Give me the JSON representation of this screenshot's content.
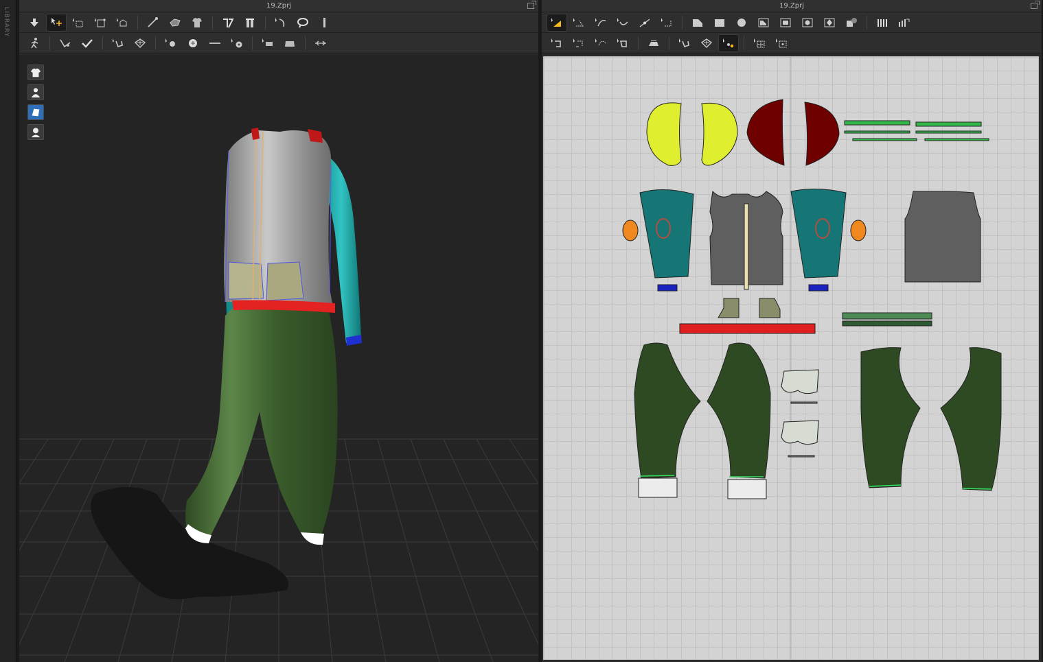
{
  "library": {
    "label": "LIBRARY"
  },
  "left_panel": {
    "title": "19.Zprj"
  },
  "right_panel": {
    "title": "19.Zprj"
  },
  "left_toolbar": {
    "row1": [
      "move-icon",
      "select-add-icon",
      "box-select-icon",
      "transform-icon",
      "rotate-icon",
      "segment-icon",
      "fold-icon",
      "garment-icon",
      "tack-icon",
      "pin-icon",
      "arrow-curve-icon",
      "lasso-icon",
      "ruler-icon"
    ],
    "row2": [
      "walk-icon",
      "simulate-icon",
      "check-icon",
      "edit-stitch-icon",
      "fabric-icon",
      "button-icon",
      "dot-icon",
      "line-icon",
      "lock-icon",
      "topstitch-icon",
      "flat-icon",
      "measure-icon"
    ]
  },
  "right_toolbar": {
    "row1": [
      "edit-pattern-icon",
      "select-points-icon",
      "curve-point-icon",
      "edit-curve-icon",
      "add-point-icon",
      "polygon-icon",
      "rectangle-icon",
      "circle-icon",
      "internal-polygon-icon",
      "internal-rect-icon",
      "internal-circle-icon",
      "dart-icon",
      "trace-icon",
      "stitch-icon",
      "fold-arr-icon"
    ],
    "row2": [
      "sew-segment-icon",
      "sew-free-icon",
      "m-n-sew-icon",
      "check-sew-icon",
      "iron-icon",
      "edit-sew-icon",
      "fabric-sew-icon",
      "symmetry-icon",
      "grid-select-icon",
      "grid-point-icon"
    ]
  },
  "colors": {
    "accent": "#f5b820",
    "yellow_piece": "#dfee2e",
    "maroon_piece": "#6e0000",
    "teal_piece": "#167575",
    "gray_piece": "#5f5f5f",
    "green_piece": "#2d4a22",
    "khaki_piece": "#8a8d6a",
    "red_band": "#e02020",
    "blue_cuff": "#1a22c0",
    "orange_patch": "#f08820"
  }
}
